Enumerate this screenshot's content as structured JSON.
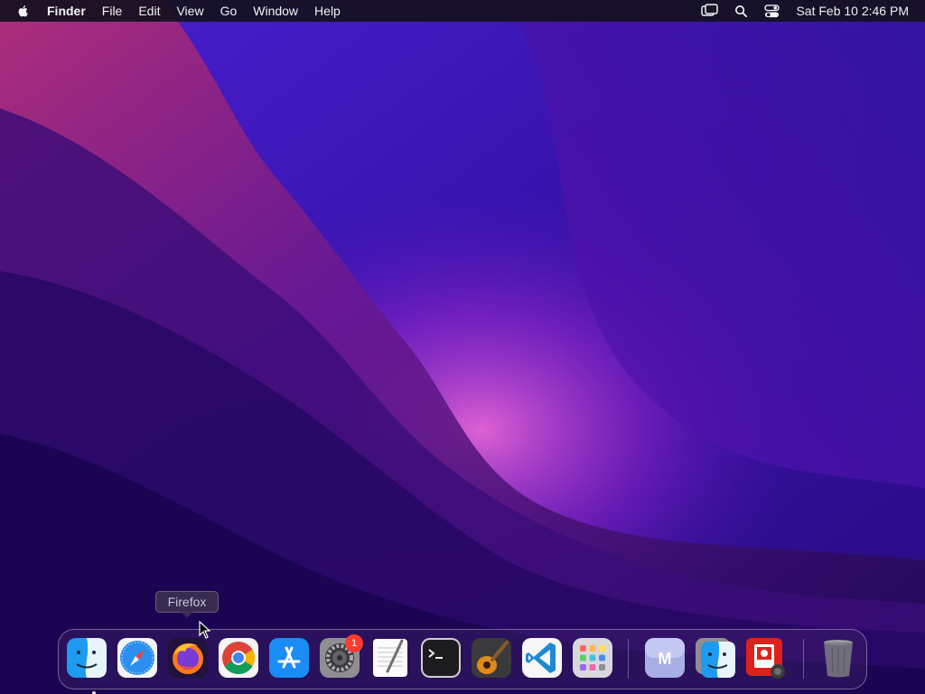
{
  "menubar": {
    "app_name": "Finder",
    "menus": [
      "File",
      "Edit",
      "View",
      "Go",
      "Window",
      "Help"
    ],
    "clock": "Sat Feb 10  2:46 PM",
    "status_icons": [
      "screen-mirroring-icon",
      "spotlight-search-icon",
      "control-center-icon"
    ]
  },
  "tooltip": {
    "label": "Firefox"
  },
  "dock": {
    "apps": [
      {
        "name": "Finder",
        "icon": "finder-icon",
        "running": true
      },
      {
        "name": "Safari",
        "icon": "safari-icon"
      },
      {
        "name": "Firefox",
        "icon": "firefox-icon"
      },
      {
        "name": "Google Chrome",
        "icon": "chrome-icon"
      },
      {
        "name": "App Store",
        "icon": "app-store-icon"
      },
      {
        "name": "System Settings",
        "icon": "system-settings-icon",
        "badge": "1"
      },
      {
        "name": "TextEdit",
        "icon": "textedit-icon"
      },
      {
        "name": "Terminal",
        "icon": "terminal-icon"
      },
      {
        "name": "GarageBand",
        "icon": "garageband-icon"
      },
      {
        "name": "Visual Studio Code",
        "icon": "vscode-icon"
      },
      {
        "name": "Launchpad",
        "icon": "launchpad-icon"
      },
      {
        "name": "M",
        "icon": "m-app-icon"
      },
      {
        "name": "Finder",
        "icon": "finder-stack-icon"
      },
      {
        "name": "Photo Booth",
        "icon": "photo-booth-icon"
      },
      {
        "name": "Trash",
        "icon": "trash-icon"
      }
    ]
  },
  "colors": {
    "menubar_bg": "#14101e",
    "badge": "#ff3b30",
    "wallpaper_primary": "#3a12a8",
    "wallpaper_accent": "#c02a9a"
  }
}
